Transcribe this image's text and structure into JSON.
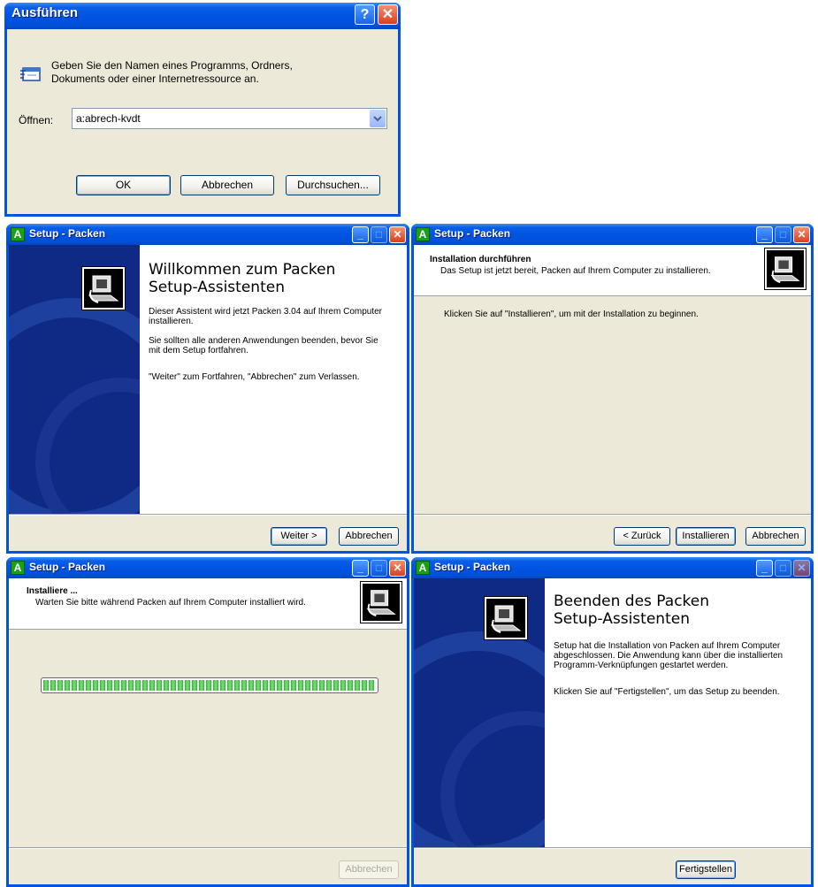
{
  "run_dialog": {
    "title": "Ausführen",
    "help_btn": "?",
    "close_btn": "✕",
    "description": "Geben Sie den Namen eines Programms, Ordners,",
    "description2": "Dokuments oder einer Internetressource an.",
    "open_label": "Öffnen:",
    "open_value": "a:abrech-kvdt",
    "ok_label": "OK",
    "cancel_label": "Abbrechen",
    "browse_label": "Durchsuchen..."
  },
  "win_welcome": {
    "title": "Setup - Packen",
    "heading1": "Willkommen zum Packen",
    "heading2": "Setup-Assistenten",
    "p1": "Dieser Assistent wird jetzt Packen 3.04 auf Ihrem Computer installieren.",
    "p2": "Sie sollten alle anderen Anwendungen beenden, bevor Sie mit dem Setup fortfahren.",
    "p3": "\"Weiter\" zum Fortfahren, \"Abbrechen\" zum Verlassen.",
    "next_label": "Weiter >",
    "cancel_label": "Abbrechen"
  },
  "win_ready": {
    "title": "Setup - Packen",
    "header_title": "Installation durchführen",
    "header_sub": "Das Setup ist jetzt bereit, Packen auf Ihrem Computer zu installieren.",
    "body": "Klicken Sie auf \"Installieren\", um mit der Installation zu beginnen.",
    "back_label": "< Zurück",
    "install_label": "Installieren",
    "cancel_label": "Abbrechen"
  },
  "win_installing": {
    "title": "Setup - Packen",
    "header_title": "Installiere ...",
    "header_sub": "Warten Sie bitte während Packen auf Ihrem Computer installiert wird.",
    "progress": 1.0,
    "cancel_label": "Abbrechen"
  },
  "win_finish": {
    "title": "Setup - Packen",
    "heading1": "Beenden des Packen",
    "heading2": "Setup-Assistenten",
    "p1": "Setup hat die Installation von Packen auf Ihrem Computer abgeschlossen. Die Anwendung kann über die installierten Programm-Verknüpfungen gestartet werden.",
    "p2": "Klicken Sie auf \"Fertigstellen\", um das Setup zu beenden.",
    "finish_label": "Fertigstellen"
  },
  "colors": {
    "xp_blue": "#0054e3",
    "face": "#ece9d8",
    "progress_green": "#2fb52f",
    "sidebar": "#0f2a84"
  }
}
